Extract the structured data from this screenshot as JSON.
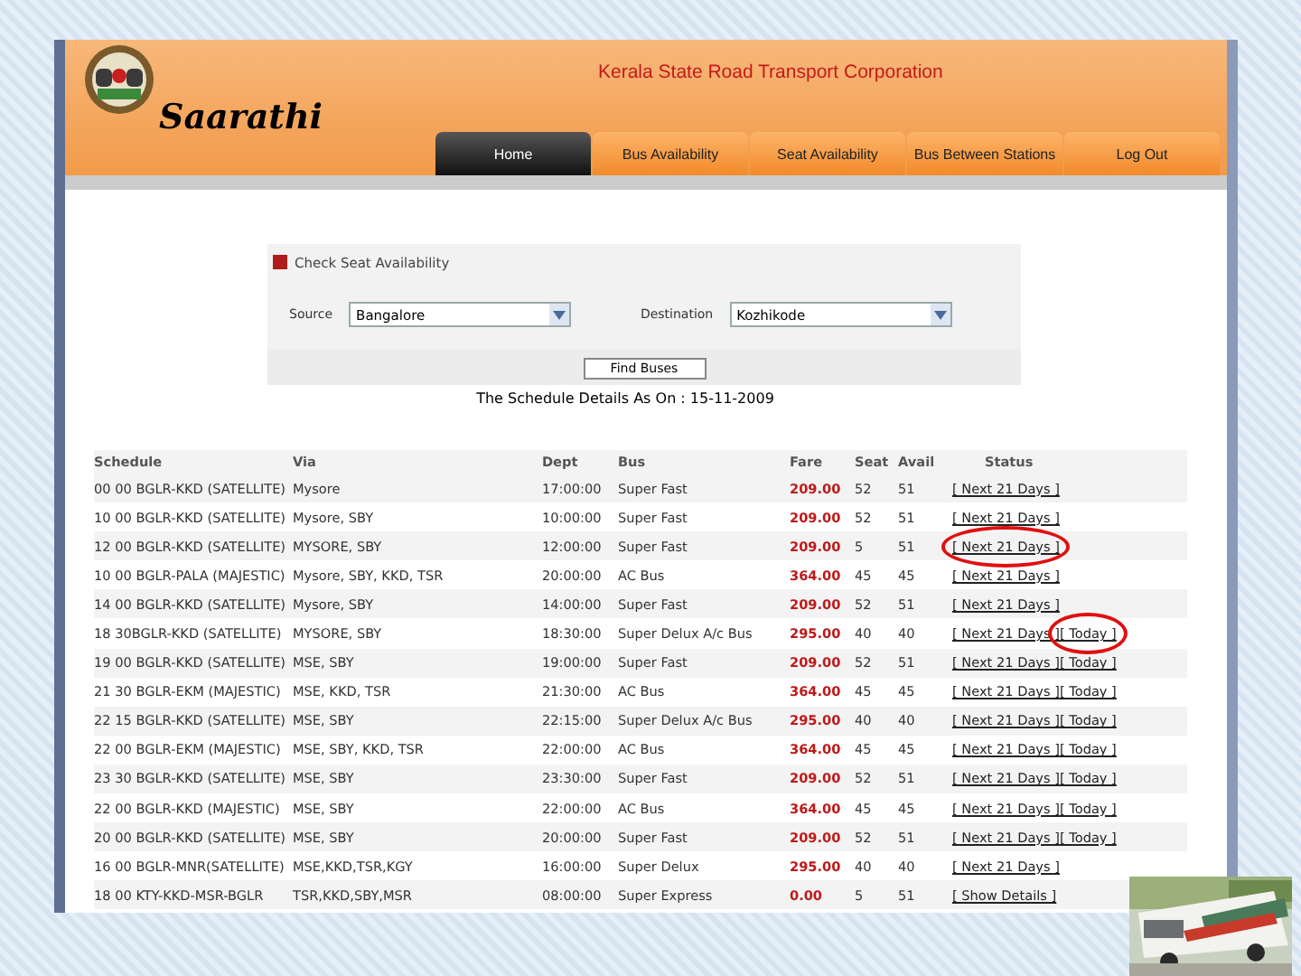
{
  "header": {
    "brand": "Saarathi",
    "organization": "Kerala State Road Transport Corporation"
  },
  "tabs": [
    {
      "label": "Home",
      "selected": true
    },
    {
      "label": "Bus Availability",
      "selected": false
    },
    {
      "label": "Seat Availability",
      "selected": false
    },
    {
      "label": "Bus Between Stations",
      "selected": false
    },
    {
      "label": "Log Out",
      "selected": false
    }
  ],
  "form": {
    "title": "Check Seat Availability",
    "source_label": "Source",
    "source": "Bangalore",
    "destination_label": "Destination",
    "destination": "Kozhikode",
    "button": "Find Buses"
  },
  "schedule_caption": "The Schedule Details As On : 15-11-2009",
  "table": {
    "columns": [
      "Schedule",
      "Via",
      "Dept",
      "Bus",
      "Fare",
      "Seat",
      "Avail",
      "Status"
    ],
    "rows": [
      {
        "cells": [
          "00 00 BGLR-KKD (SATELLITE)",
          "Mysore",
          "17:00:00",
          "Super Fast",
          "209.00",
          "52",
          "51"
        ],
        "status": [
          {
            "label": "[ Next 21 Days ]",
            "circled": false
          }
        ]
      },
      {
        "cells": [
          "10 00 BGLR-KKD (SATELLITE)",
          "Mysore, SBY",
          "10:00:00",
          "Super Fast",
          "209.00",
          "52",
          "51"
        ],
        "status": [
          {
            "label": "[ Next 21 Days ]",
            "circled": false
          }
        ]
      },
      {
        "cells": [
          "12 00 BGLR-KKD (SATELLITE)",
          "MYSORE, SBY",
          "12:00:00",
          "Super Fast",
          "209.00",
          "5",
          "51"
        ],
        "status": [
          {
            "label": "[ Next 21 Days ]",
            "circled": true
          }
        ]
      },
      {
        "cells": [
          "10 00 BGLR-PALA (MAJESTIC)",
          "Mysore, SBY, KKD, TSR",
          "20:00:00",
          "AC Bus",
          "364.00",
          "45",
          "45"
        ],
        "status": [
          {
            "label": "[ Next 21 Days ]",
            "circled": false
          }
        ]
      },
      {
        "cells": [
          "14 00 BGLR-KKD (SATELLITE)",
          "Mysore, SBY",
          "14:00:00",
          "Super Fast",
          "209.00",
          "52",
          "51"
        ],
        "status": [
          {
            "label": "[ Next 21 Days ]",
            "circled": false
          }
        ]
      },
      {
        "cells": [
          "18 30BGLR-KKD (SATELLITE)",
          "MYSORE, SBY",
          "18:30:00",
          "Super Delux A/c Bus",
          "295.00",
          "40",
          "40"
        ],
        "status": [
          {
            "label": "[ Next 21 Days ]",
            "circled": false
          },
          {
            "label": "[ Today ]",
            "circled": true
          }
        ]
      },
      {
        "cells": [
          "19 00 BGLR-KKD (SATELLITE)",
          "MSE, SBY",
          "19:00:00",
          "Super Fast",
          "209.00",
          "52",
          "51"
        ],
        "status": [
          {
            "label": "[ Next 21 Days ]",
            "circled": false
          },
          {
            "label": "[ Today ]",
            "circled": false
          }
        ]
      },
      {
        "cells": [
          "21 30 BGLR-EKM (MAJESTIC)",
          "MSE, KKD, TSR",
          "21:30:00",
          "AC Bus",
          "364.00",
          "45",
          "45"
        ],
        "status": [
          {
            "label": "[ Next 21 Days ]",
            "circled": false
          },
          {
            "label": "[ Today ]",
            "circled": false
          }
        ]
      },
      {
        "cells": [
          "22 15 BGLR-KKD (SATELLITE)",
          "MSE, SBY",
          "22:15:00",
          "Super Delux A/c Bus",
          "295.00",
          "40",
          "40"
        ],
        "status": [
          {
            "label": "[ Next 21 Days ]",
            "circled": false
          },
          {
            "label": "[ Today ]",
            "circled": false
          }
        ]
      },
      {
        "cells": [
          "22 00 BGLR-EKM (MAJESTIC)",
          "MSE, SBY, KKD, TSR",
          "22:00:00",
          "AC Bus",
          "364.00",
          "45",
          "45"
        ],
        "status": [
          {
            "label": "[ Next 21 Days ]",
            "circled": false
          },
          {
            "label": "[ Today ]",
            "circled": false
          }
        ]
      },
      {
        "cells": [
          "23 30 BGLR-KKD (SATELLITE)",
          "MSE, SBY",
          "23:30:00",
          "Super Fast",
          "209.00",
          "52",
          "51"
        ],
        "status": [
          {
            "label": "[ Next 21 Days ]",
            "circled": false
          },
          {
            "label": "[ Today ]",
            "circled": false
          }
        ]
      },
      {
        "cells": [
          "22 00 BGLR-KKD (MAJESTIC)",
          "MSE, SBY",
          "22:00:00",
          "AC Bus",
          "364.00",
          "45",
          "45"
        ],
        "status": [
          {
            "label": "[ Next 21 Days ]",
            "circled": false
          },
          {
            "label": "[ Today ]",
            "circled": false
          }
        ]
      },
      {
        "cells": [
          "20 00 BGLR-KKD (SATELLITE)",
          "MSE, SBY",
          "20:00:00",
          "Super Fast",
          "209.00",
          "52",
          "51"
        ],
        "status": [
          {
            "label": "[ Next 21 Days ]",
            "circled": false
          },
          {
            "label": "[ Today ]",
            "circled": false
          }
        ]
      },
      {
        "cells": [
          "16 00 BGLR-MNR(SATELLITE)",
          "MSE,KKD,TSR,KGY",
          "16:00:00",
          "Super Delux",
          "295.00",
          "40",
          "40"
        ],
        "status": [
          {
            "label": "[ Next 21 Days ]",
            "circled": false
          }
        ]
      },
      {
        "cells": [
          "18 00 KTY-KKD-MSR-BGLR",
          "TSR,KKD,SBY,MSR",
          "08:00:00",
          "Super Express",
          "0.00",
          "5",
          "51"
        ],
        "status": [
          {
            "label": "[ Show Details ]",
            "circled": false
          }
        ]
      }
    ]
  }
}
